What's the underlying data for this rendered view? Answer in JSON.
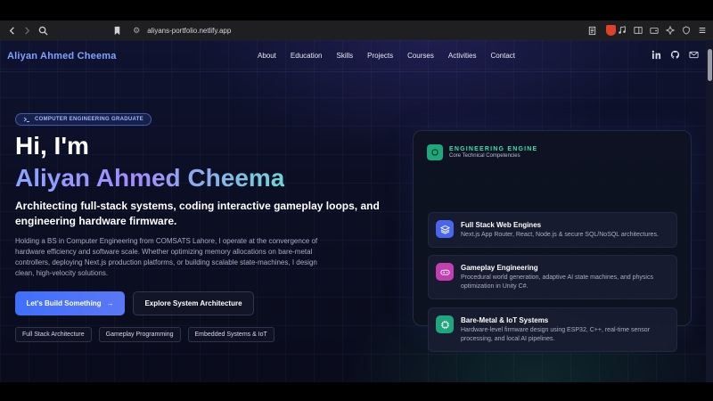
{
  "browser": {
    "url": "aliyans-portfolio.netlify.app",
    "icons": [
      "back-icon",
      "forward-icon",
      "search-icon",
      "bookmark-icon",
      "site-settings-icon",
      "reader-icon",
      "brave-shield-icon",
      "music-icon",
      "sidebar-icon",
      "wallet-icon",
      "leo-icon",
      "vpn-icon",
      "menu-icon"
    ]
  },
  "nav": {
    "brand": "Aliyan Ahmed Cheema",
    "links": [
      "About",
      "Education",
      "Skills",
      "Projects",
      "Courses",
      "Activities",
      "Contact"
    ],
    "social_icons": [
      "linkedin-icon",
      "github-icon",
      "mail-icon"
    ]
  },
  "hero": {
    "badge": "COMPUTER ENGINEERING GRADUATE",
    "greeting": "Hi, I'm",
    "name": "Aliyan Ahmed Cheema",
    "tagline": "Architecting full-stack systems, coding interactive gameplay loops, and engineering hardware firmware.",
    "description": "Holding a BS in Computer Engineering from COMSATS Lahore, I operate at the convergence of hardware efficiency and software scale. Whether optimizing memory allocations on bare-metal controllers, deploying Next.js production platforms, or building scalable state-machines, I design clean, high-velocity solutions.",
    "primary_button": "Let's Build Something",
    "secondary_button": "Explore System Architecture",
    "chips": [
      "Full Stack Architecture",
      "Gameplay Programming",
      "Embedded Systems & IoT"
    ]
  },
  "engine": {
    "title": "ENGINEERING ENGINE",
    "subtitle": "Core Technical Competencies",
    "cards": [
      {
        "title": "Full Stack Web Engines",
        "text": "Next.js App Router, React, Node.js & secure SQL/NoSQL architectures.",
        "color": "#4a66f0"
      },
      {
        "title": "Gameplay Engineering",
        "text": "Procedural world generation, adaptive AI state machines, and physics optimization in Unity C#.",
        "color": "#c23fb0"
      },
      {
        "title": "Bare-Metal & IoT Systems",
        "text": "Hardware-level firmware design using ESP32, C++, real-time sensor processing, and local AI pipelines.",
        "color": "#1ea77a"
      }
    ]
  }
}
